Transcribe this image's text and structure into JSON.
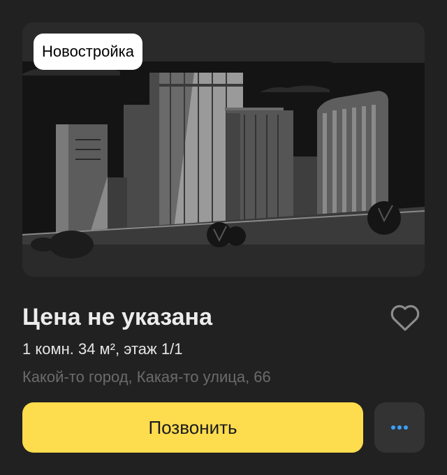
{
  "listing": {
    "badge": "Новостройка",
    "price": "Цена не указана",
    "details": "1 комн. 34 м², этаж 1/1",
    "address": "Какой-то город, Какая-то улица, 66"
  },
  "actions": {
    "call_label": "Позвонить",
    "favorite_icon": "heart-icon",
    "more_icon": "more-dots-icon"
  },
  "colors": {
    "background": "#212121",
    "call_button": "#fddc4e",
    "more_button": "#333333",
    "more_dots": "#3aa0ff",
    "address_text": "#6b6b6b"
  }
}
